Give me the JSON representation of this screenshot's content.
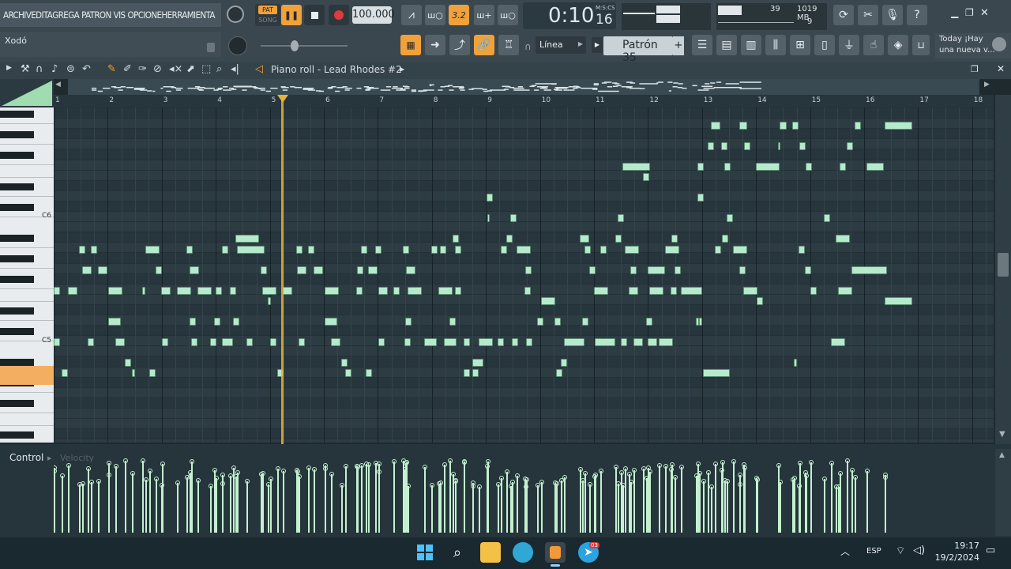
{
  "menu": {
    "items": [
      "ARCHIV",
      "EDITA",
      "GREGA",
      "PATRON",
      "VIS",
      "OPCIONE",
      "HERRAMIENTA"
    ]
  },
  "hint": {
    "text": "Xodó"
  },
  "transport": {
    "pat_label": "PAT",
    "song_label": "SONG",
    "tempo": "100.000",
    "time_main": "0:10",
    "time_frac": "16",
    "time_format": "M:S:CS",
    "snap_step": "3.2"
  },
  "monitor": {
    "cpu": "39",
    "memory": "1019 MB",
    "voices": "9"
  },
  "snap": {
    "label": "Línea"
  },
  "pattern": {
    "name": "Patrón 35",
    "plus": "+"
  },
  "news": {
    "line1": "Today  ¡Hay",
    "line2": "una nueva v..."
  },
  "pianoroll": {
    "title": "Piano roll - Lead Rhodes #2"
  },
  "timeline": {
    "bars": [
      "1",
      "2",
      "3",
      "4",
      "5",
      "6",
      "7",
      "8",
      "9",
      "10",
      "11",
      "12",
      "13",
      "14",
      "15",
      "16",
      "17",
      "18"
    ]
  },
  "keyboard": {
    "labels": [
      "C6",
      "C5"
    ]
  },
  "control": {
    "label": "Control",
    "target": "Velocity"
  },
  "taskbar": {
    "language": "ESP",
    "time": "19:17",
    "date": "19/2/2024",
    "badge": "03"
  },
  "colors": {
    "accent": "#f0a13a",
    "note": "#b6eacc",
    "playhead": "#e8b13a"
  },
  "notes": [
    [
      900,
      12,
      159
    ],
    [
      936,
      10,
      159
    ],
    [
      987,
      9,
      159
    ],
    [
      1003,
      8,
      159
    ],
    [
      1082,
      8,
      159
    ],
    [
      1120,
      35,
      159
    ],
    [
      896,
      8,
      185
    ],
    [
      913,
      8,
      185
    ],
    [
      942,
      8,
      185
    ],
    [
      985,
      2,
      185
    ],
    [
      1012,
      8,
      185
    ],
    [
      1072,
      8,
      185
    ],
    [
      788,
      35,
      211
    ],
    [
      883,
      8,
      211
    ],
    [
      917,
      8,
      211
    ],
    [
      957,
      30,
      211
    ],
    [
      1020,
      8,
      211
    ],
    [
      1063,
      8,
      211
    ],
    [
      1097,
      22,
      211
    ],
    [
      814,
      8,
      224
    ],
    [
      616,
      8,
      250
    ],
    [
      883,
      8,
      250
    ],
    [
      617,
      2,
      276
    ],
    [
      646,
      8,
      276
    ],
    [
      782,
      8,
      276
    ],
    [
      920,
      8,
      276
    ],
    [
      1043,
      8,
      276
    ],
    [
      298,
      30,
      302
    ],
    [
      573,
      8,
      302
    ],
    [
      641,
      8,
      302
    ],
    [
      734,
      12,
      302
    ],
    [
      779,
      8,
      302
    ],
    [
      850,
      8,
      302
    ],
    [
      914,
      8,
      302
    ],
    [
      1058,
      18,
      302
    ],
    [
      100,
      8,
      316
    ],
    [
      115,
      8,
      316
    ],
    [
      184,
      18,
      316
    ],
    [
      236,
      8,
      316
    ],
    [
      281,
      8,
      316
    ],
    [
      300,
      35,
      316
    ],
    [
      375,
      8,
      316
    ],
    [
      390,
      8,
      316
    ],
    [
      457,
      8,
      316
    ],
    [
      475,
      8,
      316
    ],
    [
      510,
      8,
      316
    ],
    [
      546,
      8,
      316
    ],
    [
      557,
      8,
      316
    ],
    [
      576,
      8,
      316
    ],
    [
      634,
      8,
      316
    ],
    [
      654,
      18,
      316
    ],
    [
      740,
      8,
      316
    ],
    [
      760,
      8,
      316
    ],
    [
      791,
      18,
      316
    ],
    [
      842,
      18,
      316
    ],
    [
      905,
      8,
      316
    ],
    [
      928,
      18,
      316
    ],
    [
      1011,
      8,
      316
    ],
    [
      104,
      12,
      342
    ],
    [
      124,
      12,
      342
    ],
    [
      197,
      8,
      342
    ],
    [
      240,
      12,
      342
    ],
    [
      330,
      8,
      342
    ],
    [
      376,
      12,
      342
    ],
    [
      397,
      12,
      342
    ],
    [
      452,
      8,
      342
    ],
    [
      466,
      12,
      342
    ],
    [
      514,
      12,
      342
    ],
    [
      665,
      8,
      342
    ],
    [
      746,
      8,
      342
    ],
    [
      798,
      8,
      342
    ],
    [
      820,
      22,
      342
    ],
    [
      854,
      8,
      342
    ],
    [
      936,
      8,
      342
    ],
    [
      1019,
      8,
      342
    ],
    [
      1078,
      45,
      342
    ],
    [
      68,
      8,
      368
    ],
    [
      86,
      12,
      368
    ],
    [
      137,
      18,
      368
    ],
    [
      180,
      4,
      368
    ],
    [
      204,
      12,
      368
    ],
    [
      224,
      18,
      368
    ],
    [
      250,
      18,
      368
    ],
    [
      273,
      8,
      368
    ],
    [
      291,
      8,
      368
    ],
    [
      332,
      18,
      368
    ],
    [
      358,
      12,
      368
    ],
    [
      411,
      18,
      368
    ],
    [
      451,
      8,
      368
    ],
    [
      479,
      12,
      368
    ],
    [
      498,
      8,
      368
    ],
    [
      516,
      18,
      368
    ],
    [
      555,
      18,
      368
    ],
    [
      576,
      8,
      368
    ],
    [
      664,
      8,
      368
    ],
    [
      752,
      18,
      368
    ],
    [
      796,
      12,
      368
    ],
    [
      822,
      18,
      368
    ],
    [
      849,
      8,
      368
    ],
    [
      862,
      27,
      368
    ],
    [
      941,
      18,
      368
    ],
    [
      1026,
      8,
      368
    ],
    [
      1061,
      18,
      368
    ],
    [
      339,
      4,
      381
    ],
    [
      685,
      18,
      381
    ],
    [
      958,
      8,
      381
    ],
    [
      1120,
      35,
      381
    ],
    [
      137,
      16,
      407
    ],
    [
      240,
      8,
      407
    ],
    [
      271,
      8,
      407
    ],
    [
      295,
      8,
      407
    ],
    [
      411,
      16,
      407
    ],
    [
      513,
      8,
      407
    ],
    [
      569,
      8,
      407
    ],
    [
      680,
      8,
      407
    ],
    [
      702,
      8,
      407
    ],
    [
      737,
      8,
      407
    ],
    [
      818,
      8,
      407
    ],
    [
      881,
      4,
      407
    ],
    [
      885,
      4,
      407
    ],
    [
      68,
      8,
      433
    ],
    [
      111,
      8,
      433
    ],
    [
      146,
      12,
      433
    ],
    [
      205,
      8,
      433
    ],
    [
      242,
      8,
      433
    ],
    [
      266,
      8,
      433
    ],
    [
      281,
      14,
      433
    ],
    [
      312,
      8,
      433
    ],
    [
      342,
      8,
      433
    ],
    [
      378,
      8,
      433
    ],
    [
      419,
      12,
      433
    ],
    [
      479,
      8,
      433
    ],
    [
      512,
      8,
      433
    ],
    [
      537,
      16,
      433
    ],
    [
      562,
      16,
      433
    ],
    [
      587,
      8,
      433
    ],
    [
      606,
      18,
      433
    ],
    [
      630,
      8,
      433
    ],
    [
      648,
      8,
      433
    ],
    [
      666,
      8,
      433
    ],
    [
      714,
      26,
      433
    ],
    [
      753,
      26,
      433
    ],
    [
      786,
      8,
      433
    ],
    [
      802,
      12,
      433
    ],
    [
      820,
      12,
      433
    ],
    [
      834,
      18,
      433
    ],
    [
      1052,
      18,
      433
    ],
    [
      158,
      8,
      459
    ],
    [
      432,
      8,
      459
    ],
    [
      598,
      14,
      459
    ],
    [
      710,
      8,
      459
    ],
    [
      1005,
      4,
      459
    ],
    [
      78,
      8,
      472
    ],
    [
      167,
      4,
      472
    ],
    [
      189,
      8,
      472
    ],
    [
      351,
      8,
      472
    ],
    [
      437,
      8,
      472
    ],
    [
      463,
      8,
      472
    ],
    [
      587,
      8,
      472
    ],
    [
      598,
      8,
      472
    ],
    [
      704,
      8,
      472
    ],
    [
      890,
      34,
      472
    ]
  ]
}
